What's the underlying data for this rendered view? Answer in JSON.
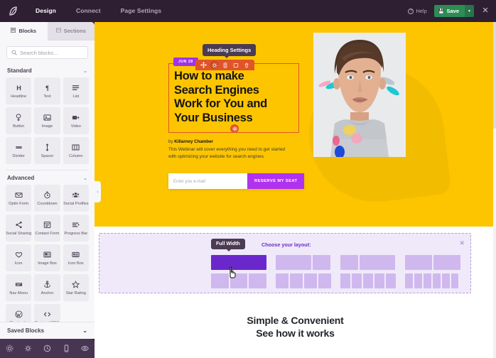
{
  "topbar": {
    "logo_icon": "leaf-logo-icon",
    "nav": [
      {
        "label": "Design",
        "active": true
      },
      {
        "label": "Connect",
        "active": false
      },
      {
        "label": "Page Settings",
        "active": false
      }
    ],
    "help_label": "Help",
    "help_icon": "question-circle-icon",
    "save_label": "Save",
    "save_icon": "floppy-disk-icon",
    "save_caret_icon": "chevron-down-icon",
    "close_icon": "close-icon",
    "bg_color": "#2e1f33",
    "save_color": "#2d8c54"
  },
  "panel": {
    "tabs": [
      {
        "label": "Blocks",
        "icon": "blocks-icon",
        "active": true
      },
      {
        "label": "Sections",
        "icon": "sections-icon",
        "active": false
      }
    ],
    "search": {
      "placeholder": "Search blocks...",
      "value": "",
      "icon": "search-icon"
    },
    "groups": [
      {
        "title": "Standard",
        "chevron_icon": "chevron-down-icon",
        "blocks": [
          {
            "label": "Headline",
            "icon": "headline-h-icon"
          },
          {
            "label": "Text",
            "icon": "paragraph-pilcrow-icon"
          },
          {
            "label": "List",
            "icon": "list-icon"
          },
          {
            "label": "Button",
            "icon": "button-click-icon"
          },
          {
            "label": "Image",
            "icon": "image-icon"
          },
          {
            "label": "Video",
            "icon": "video-camera-icon"
          },
          {
            "label": "Divider",
            "icon": "divider-icon"
          },
          {
            "label": "Spacer",
            "icon": "spacer-arrows-icon"
          },
          {
            "label": "Column",
            "icon": "columns-icon"
          }
        ]
      },
      {
        "title": "Advanced",
        "chevron_icon": "chevron-down-icon",
        "blocks": [
          {
            "label": "Optin Form",
            "icon": "envelope-icon"
          },
          {
            "label": "Countdown",
            "icon": "stopwatch-icon"
          },
          {
            "label": "Social Profiles",
            "icon": "people-group-icon"
          },
          {
            "label": "Social Sharing",
            "icon": "share-nodes-icon"
          },
          {
            "label": "Contact Form",
            "icon": "contact-form-icon"
          },
          {
            "label": "Progress Bar",
            "icon": "progress-bar-icon"
          },
          {
            "label": "Icon",
            "icon": "heart-icon"
          },
          {
            "label": "Image Box",
            "icon": "image-box-icon"
          },
          {
            "label": "Icon Box",
            "icon": "icon-box-icon"
          },
          {
            "label": "Nav Menu",
            "icon": "nav-menu-icon"
          },
          {
            "label": "Anchor",
            "icon": "anchor-icon"
          },
          {
            "label": "Star Rating",
            "icon": "star-icon"
          },
          {
            "label": "Shortcode",
            "icon": "wordpress-icon"
          },
          {
            "label": "Custom HTML",
            "icon": "code-brackets-icon"
          }
        ]
      }
    ],
    "saved_blocks": {
      "title": "Saved Blocks",
      "chevron_icon": "chevron-down-icon"
    },
    "collapse_icon": "chevron-left-icon"
  },
  "dock": {
    "items": [
      {
        "icon": "gear-settings-icon",
        "name": "global-settings"
      },
      {
        "icon": "color-palette-icon",
        "name": "theme-colors"
      },
      {
        "icon": "history-clock-icon",
        "name": "revision-history"
      },
      {
        "icon": "mobile-device-icon",
        "name": "responsive-preview"
      },
      {
        "icon": "eye-preview-icon",
        "name": "preview"
      }
    ],
    "bg_color": "#473551"
  },
  "canvas": {
    "hero": {
      "bg_color": "#fdc500",
      "date_badge": "JUN 28",
      "badge_color": "#a032e8",
      "heading_lines": [
        "How to make",
        "Search Engines",
        "Work for You and",
        "Your Business"
      ],
      "heading_outline_color": "#e0542a",
      "tooltip": "Heading Settings",
      "toolbar_icons": [
        {
          "icon": "move-arrows-icon",
          "selected": false
        },
        {
          "icon": "gear-settings-icon",
          "selected": true
        },
        {
          "icon": "edit-pencil-icon",
          "selected": false
        },
        {
          "icon": "duplicate-copy-icon",
          "selected": false
        },
        {
          "icon": "trash-delete-icon",
          "selected": false
        }
      ],
      "handle_icon": "gear-settings-icon",
      "byline_prefix": "by ",
      "byline_author": "Killarney Chamber",
      "description": "This Webinar will cover everything you need to get started with optimizing your website for search engines.",
      "form": {
        "placeholder": "Enter you e-mail",
        "value": "",
        "button_label": "RESERVE MY SEAT",
        "button_color": "#b032f0"
      },
      "photo_alt": "young-man-portrait-photo"
    },
    "layout_picker": {
      "tooltip": "Full Width",
      "label": "Choose your layout:",
      "close_icon": "close-icon",
      "accent_color": "#6a28cc",
      "cursor_icon": "pointer-hand-cursor",
      "options": [
        {
          "name": "layout-1-column",
          "cells": [
            100
          ],
          "selected": true
        },
        {
          "name": "layout-2-column-wide-narrow",
          "cells": [
            64,
            32
          ],
          "selected": false
        },
        {
          "name": "layout-2-column-narrow-wide",
          "cells": [
            32,
            64
          ],
          "selected": false
        },
        {
          "name": "layout-2-column-equal",
          "cells": [
            49,
            49
          ],
          "selected": false
        },
        {
          "name": "layout-3-column",
          "cells": [
            32,
            32,
            32
          ],
          "selected": false
        },
        {
          "name": "layout-4-column",
          "cells": [
            23,
            23,
            23,
            23
          ],
          "selected": false
        },
        {
          "name": "layout-5-column",
          "cells": [
            18,
            18,
            18,
            18,
            18
          ],
          "selected": false
        },
        {
          "name": "layout-6-column",
          "cells": [
            14,
            14,
            14,
            14,
            14,
            14
          ],
          "selected": false
        }
      ]
    },
    "bottom_section": {
      "title_line1": "Simple & Convenient",
      "title_line2": "See how it works"
    }
  }
}
